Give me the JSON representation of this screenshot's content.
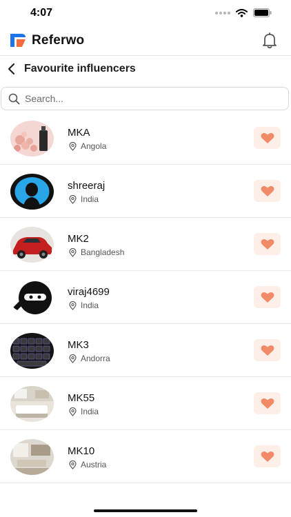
{
  "status_bar": {
    "time": "4:07"
  },
  "app": {
    "brand": "Referwo"
  },
  "page": {
    "title": "Favourite influencers"
  },
  "search": {
    "placeholder": "Search...",
    "value": ""
  },
  "colors": {
    "accent": "#f08a67",
    "fav_bg": "#fdeee7",
    "logo_blue": "#1e73e8",
    "logo_orange": "#f36b3d"
  },
  "influencers": [
    {
      "name": "MKA",
      "location": "Angola",
      "avatar": "pink-crystals-bottle-photo",
      "favourited": true
    },
    {
      "name": "shreeraj",
      "location": "India",
      "avatar": "silhouette-on-blue-photo",
      "favourited": true
    },
    {
      "name": "MK2",
      "location": "Bangladesh",
      "avatar": "red-car-photo",
      "favourited": true
    },
    {
      "name": "viraj4699",
      "location": "India",
      "avatar": "ninja-mask-photo",
      "favourited": true
    },
    {
      "name": "MK3",
      "location": "Andorra",
      "avatar": "rgb-keyboard-photo",
      "favourited": true
    },
    {
      "name": "MK55",
      "location": "India",
      "avatar": "living-room-photo",
      "favourited": true
    },
    {
      "name": "MK10",
      "location": "Austria",
      "avatar": "interior-room-photo",
      "favourited": true
    }
  ]
}
